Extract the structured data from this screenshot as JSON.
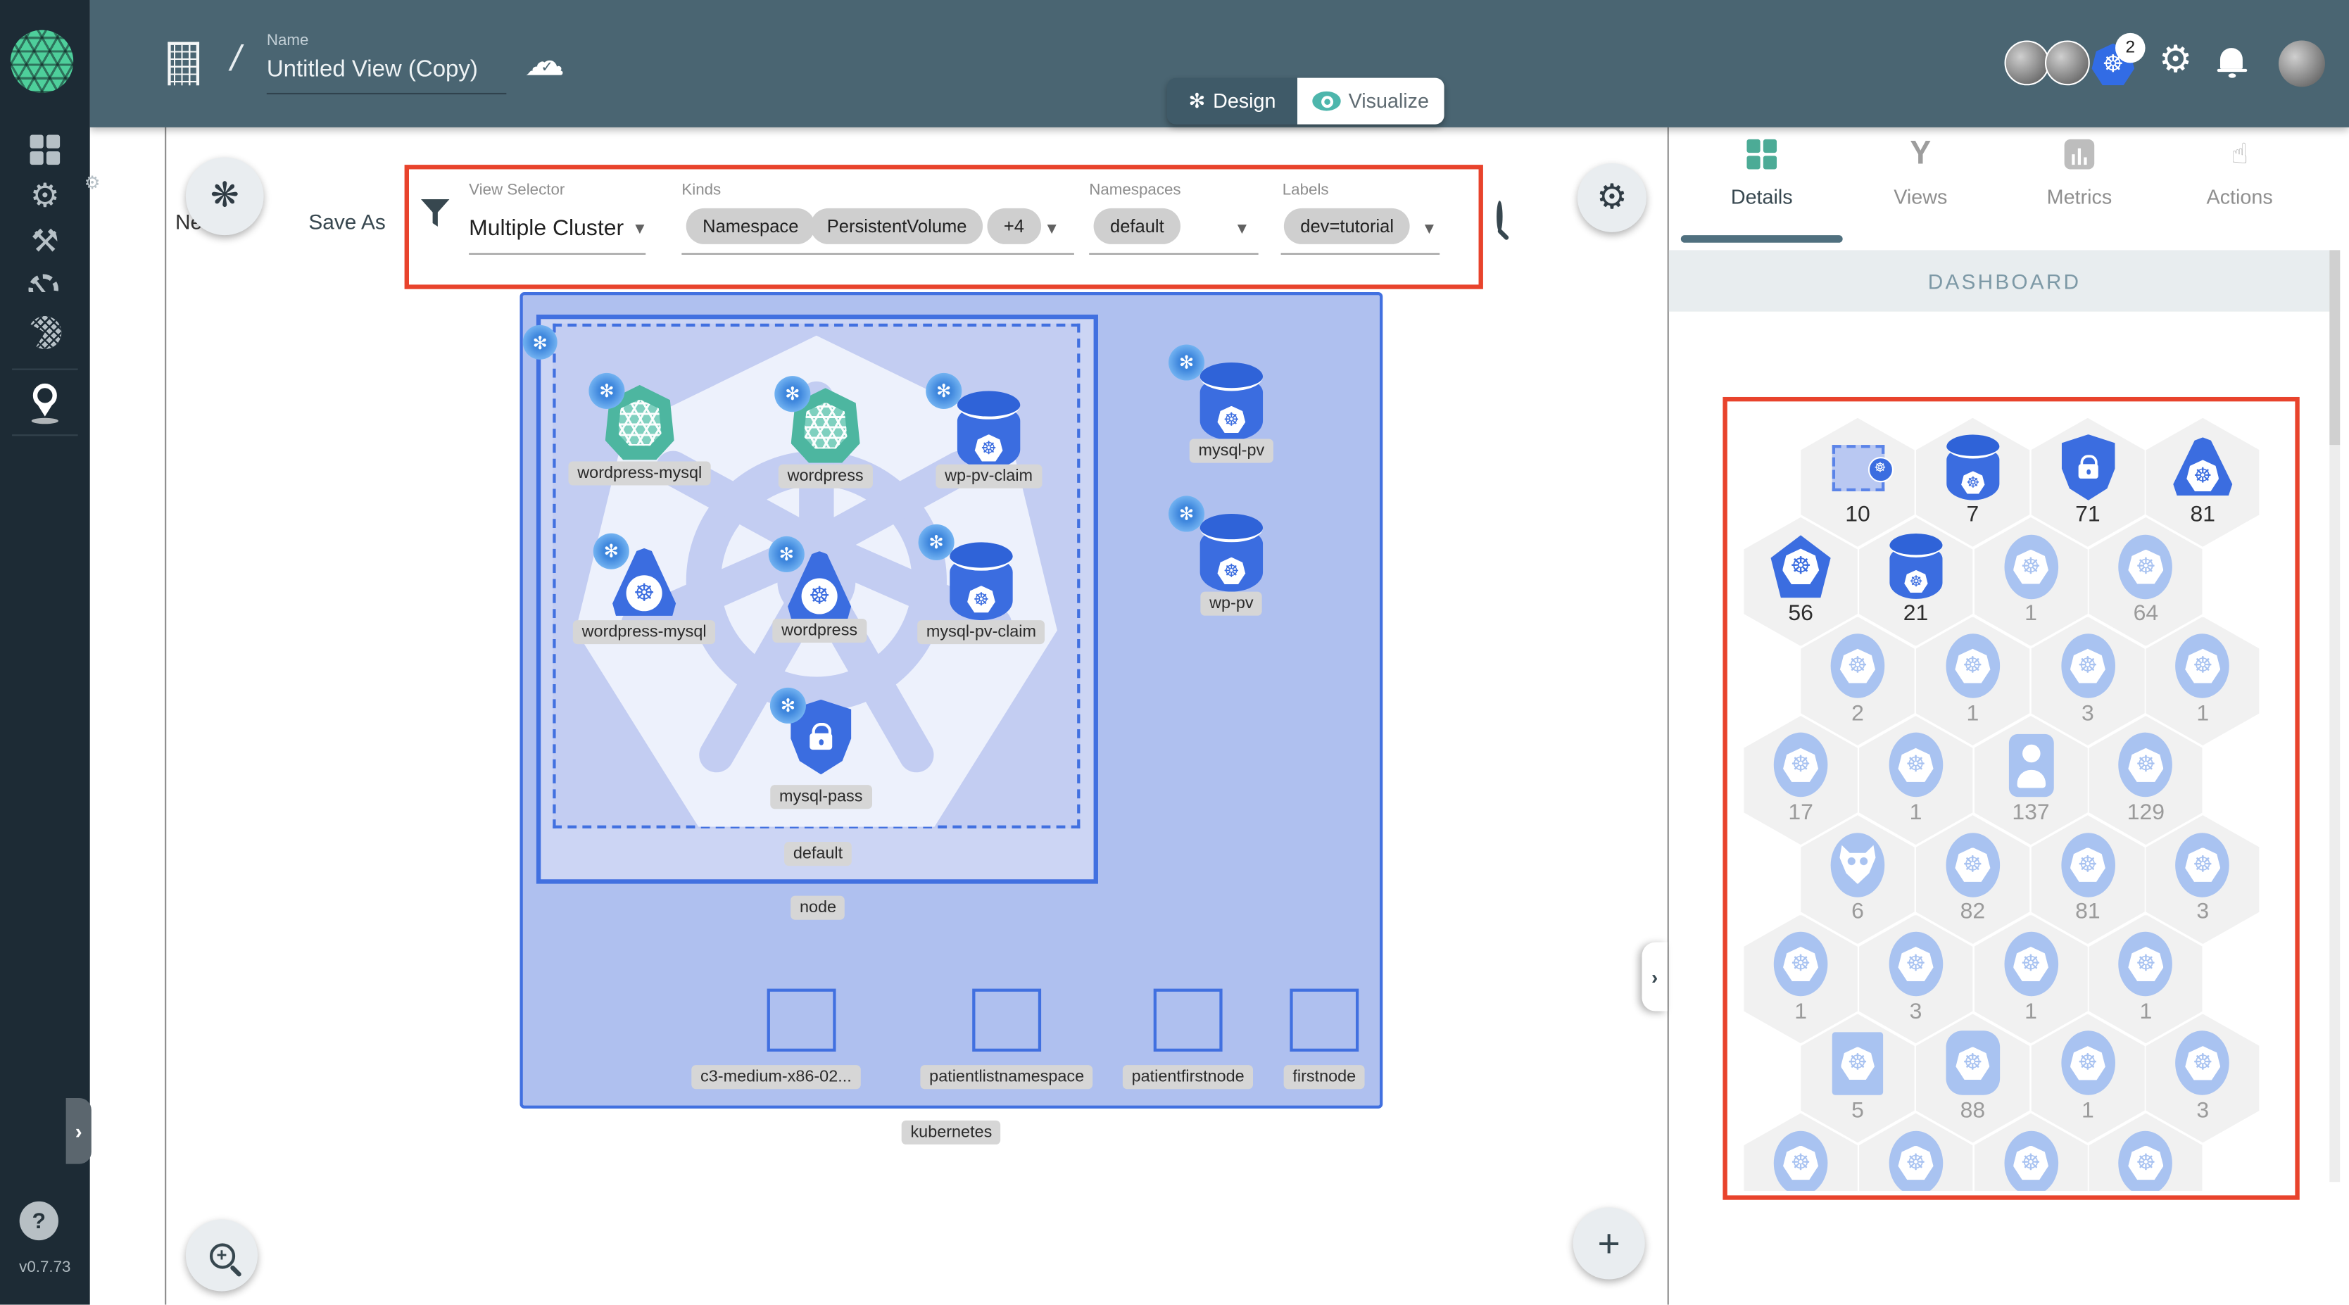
{
  "app": {
    "version": "v0.7.73",
    "help_glyph": "?"
  },
  "icons": {
    "k8s_wheel": "☸",
    "spiral": "✻",
    "gear": "⚙",
    "cloud": "☁",
    "check": "✓",
    "caret_down": "▼",
    "plus": "+",
    "chevron_right": "›",
    "slash": "/",
    "tools": "⚒",
    "pointer": "☝",
    "pencil": "✎",
    "wa": "WA"
  },
  "header": {
    "name_label": "Name",
    "name_value": "Untitled View (Copy)",
    "mode_toggle": {
      "design": "Design",
      "visualize": "Visualize"
    },
    "k8s_context_count": "2"
  },
  "toolbar": {
    "new_label": "New",
    "save_as_label": "Save As",
    "view_selector": {
      "label": "View Selector",
      "value": "Multiple Cluster"
    },
    "kinds": {
      "label": "Kinds",
      "chips": [
        "Namespace",
        "PersistentVolume",
        "+4"
      ]
    },
    "namespaces": {
      "label": "Namespaces",
      "chips": [
        "default"
      ]
    },
    "labels": {
      "label": "Labels",
      "chips": [
        "dev=tutorial"
      ]
    }
  },
  "canvas": {
    "cluster_label": "kubernetes",
    "node_label": "node",
    "namespace_label": "default",
    "items": [
      {
        "label": "wordpress-mysql",
        "kind": "deployment"
      },
      {
        "label": "wordpress",
        "kind": "deployment"
      },
      {
        "label": "wp-pv-claim",
        "kind": "volume"
      },
      {
        "label": "wordpress-mysql",
        "kind": "service"
      },
      {
        "label": "wordpress",
        "kind": "service"
      },
      {
        "label": "mysql-pv-claim",
        "kind": "volume"
      },
      {
        "label": "mysql-pass",
        "kind": "secret"
      },
      {
        "label": "mysql-pv",
        "kind": "volume"
      },
      {
        "label": "wp-pv",
        "kind": "volume"
      }
    ],
    "machines": [
      "c3-medium-x86-02...",
      "patientlistnamespace",
      "patientfirstnode",
      "firstnode"
    ]
  },
  "panel": {
    "tabs": [
      {
        "label": "Details",
        "active": true
      },
      {
        "label": "Views",
        "active": false
      },
      {
        "label": "Metrics",
        "active": false
      },
      {
        "label": "Actions",
        "active": false
      }
    ],
    "section_title": "DASHBOARD",
    "hexes": [
      {
        "icon": "namespace",
        "count": "10",
        "dark": true
      },
      {
        "icon": "volume",
        "count": "7",
        "dark": true
      },
      {
        "icon": "secret",
        "count": "71",
        "dark": true
      },
      {
        "icon": "service",
        "count": "81",
        "dark": true
      },
      {
        "icon": "pod",
        "count": "56",
        "dark": true
      },
      {
        "icon": "volume",
        "count": "21",
        "dark": true
      },
      {
        "icon": "k8s",
        "count": "1",
        "dark": false
      },
      {
        "icon": "k8s",
        "count": "64",
        "dark": false
      },
      {
        "icon": "k8s",
        "count": "2",
        "dark": false
      },
      {
        "icon": "k8s",
        "count": "1",
        "dark": false
      },
      {
        "icon": "k8s",
        "count": "3",
        "dark": false
      },
      {
        "icon": "k8s",
        "count": "1",
        "dark": false
      },
      {
        "icon": "k8s",
        "count": "17",
        "dark": false
      },
      {
        "icon": "k8s",
        "count": "1",
        "dark": false
      },
      {
        "icon": "user",
        "count": "137",
        "dark": false
      },
      {
        "icon": "k8s",
        "count": "129",
        "dark": false
      },
      {
        "icon": "daemon",
        "count": "6",
        "dark": false
      },
      {
        "icon": "k8s",
        "count": "82",
        "dark": false
      },
      {
        "icon": "k8s",
        "count": "81",
        "dark": false
      },
      {
        "icon": "k8s",
        "count": "3",
        "dark": false
      },
      {
        "icon": "k8s",
        "count": "1",
        "dark": false
      },
      {
        "icon": "k8s",
        "count": "3",
        "dark": false
      },
      {
        "icon": "k8s",
        "count": "1",
        "dark": false
      },
      {
        "icon": "k8s",
        "count": "1",
        "dark": false
      },
      {
        "icon": "square",
        "count": "5",
        "dark": false
      },
      {
        "icon": "roundsquare",
        "count": "88",
        "dark": false
      },
      {
        "icon": "k8s",
        "count": "1",
        "dark": false
      },
      {
        "icon": "k8s",
        "count": "3",
        "dark": false
      },
      {
        "icon": "k8s",
        "count": "",
        "dark": false
      },
      {
        "icon": "k8s",
        "count": "",
        "dark": false
      },
      {
        "icon": "k8s",
        "count": "",
        "dark": false
      },
      {
        "icon": "k8s",
        "count": "",
        "dark": false
      }
    ]
  },
  "colors": {
    "accent_teal": "#4db6ac",
    "header": "#4a6572",
    "sidebar": "#1d2b35",
    "k8s_blue": "#3b6de0",
    "light_blue": "#a9c3f1",
    "cluster_fill": "#afc0ef",
    "node_fill": "#ccd5f4",
    "namespace_fill": "#c3cdf2",
    "annotation_red": "#e8432c",
    "chip_grey": "#d6d6d6",
    "deployment_green": "#4db6a0"
  }
}
